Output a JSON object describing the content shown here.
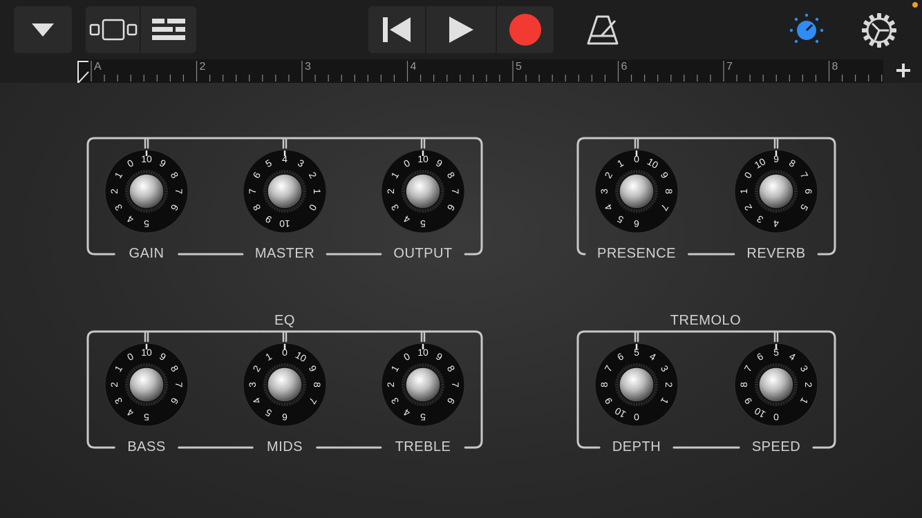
{
  "toolbar": {
    "icons": [
      "dropdown-arrow-icon",
      "tracks-view-icon",
      "mixer-controls-icon",
      "rewind-icon",
      "play-icon",
      "record-icon",
      "metronome-icon",
      "controls-knob-icon",
      "settings-gear-icon",
      "add-icon"
    ],
    "colors": {
      "record": "#f23a32",
      "active_knob": "#2f8cf5",
      "status_dot": "#f0a020"
    }
  },
  "ruler": {
    "marks": [
      "A",
      "2",
      "3",
      "4",
      "5",
      "6",
      "7",
      "8"
    ]
  },
  "panels": {
    "amp": {
      "knobs": [
        {
          "label": "GAIN",
          "scale": [
            "5",
            "4",
            "3",
            "2",
            "1",
            "0",
            "10",
            "9",
            "8",
            "7",
            "6"
          ]
        },
        {
          "label": "MASTER",
          "scale": [
            "10",
            "9",
            "8",
            "7",
            "6",
            "5",
            "4",
            "3",
            "2",
            "1",
            "0"
          ]
        },
        {
          "label": "OUTPUT",
          "scale": [
            "5",
            "4",
            "3",
            "2",
            "1",
            "0",
            "10",
            "9",
            "8",
            "7",
            "6"
          ]
        }
      ]
    },
    "presence_reverb": {
      "knobs": [
        {
          "label": "PRESENCE",
          "scale": [
            "6",
            "5",
            "4",
            "3",
            "2",
            "1",
            "0",
            "10",
            "9",
            "8",
            "7"
          ]
        },
        {
          "label": "REVERB",
          "scale": [
            "4",
            "3",
            "2",
            "1",
            "0",
            "10",
            "9",
            "8",
            "7",
            "6",
            "5"
          ]
        }
      ]
    },
    "eq": {
      "title": "EQ",
      "knobs": [
        {
          "label": "BASS",
          "scale": [
            "5",
            "4",
            "3",
            "2",
            "1",
            "0",
            "10",
            "9",
            "8",
            "7",
            "6"
          ]
        },
        {
          "label": "MIDS",
          "scale": [
            "6",
            "5",
            "4",
            "3",
            "2",
            "1",
            "0",
            "10",
            "9",
            "8",
            "7"
          ]
        },
        {
          "label": "TREBLE",
          "scale": [
            "5",
            "4",
            "3",
            "2",
            "1",
            "0",
            "10",
            "9",
            "8",
            "7",
            "6"
          ]
        }
      ]
    },
    "tremolo": {
      "title": "TREMOLO",
      "knobs": [
        {
          "label": "DEPTH",
          "scale": [
            "0",
            "10",
            "9",
            "8",
            "7",
            "6",
            "5",
            "4",
            "3",
            "2",
            "1"
          ]
        },
        {
          "label": "SPEED",
          "scale": [
            "0",
            "10",
            "9",
            "8",
            "7",
            "6",
            "5",
            "4",
            "3",
            "2",
            "1"
          ]
        }
      ]
    }
  }
}
